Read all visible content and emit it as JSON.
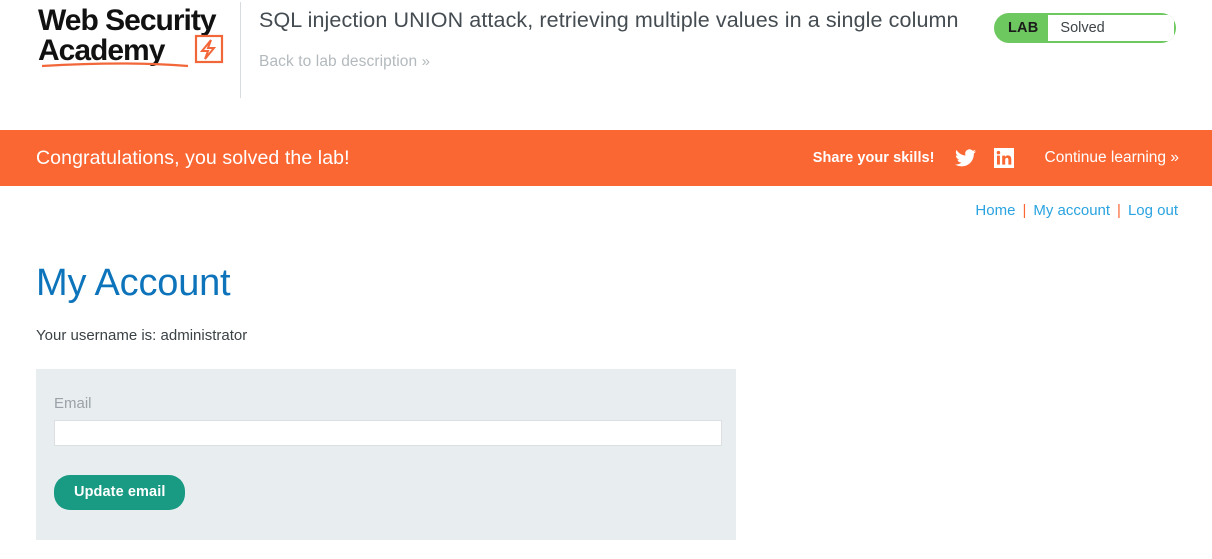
{
  "header": {
    "logo": {
      "line1": "Web Security",
      "line2": "Academy",
      "icon": "lightning-bolt-icon"
    },
    "lab_title": "SQL injection UNION attack, retrieving multiple values in a single column",
    "back_link": "Back to lab description",
    "back_link_chevron": "»",
    "lab_status": {
      "tag": "LAB",
      "state": "Solved",
      "green": "#6dc95f"
    }
  },
  "banner": {
    "message": "Congratulations, you solved the lab!",
    "share_label": "Share your skills!",
    "twitter_icon": "twitter-icon",
    "linkedin_icon": "linkedin-icon",
    "continue_label": "Continue learning",
    "continue_chevron": "»",
    "background": "#fa6733"
  },
  "nav": {
    "items": [
      {
        "label": "Home"
      },
      {
        "label": "My account"
      },
      {
        "label": "Log out"
      }
    ],
    "separator": "|",
    "link_color": "#2aa3e0"
  },
  "main": {
    "page_title": "My Account",
    "username_line": "Your username is: administrator",
    "form": {
      "email_label": "Email",
      "email_value": "",
      "email_placeholder": "",
      "submit_label": "Update email",
      "panel_background": "#e8edf0",
      "button_color": "#189a83"
    }
  }
}
